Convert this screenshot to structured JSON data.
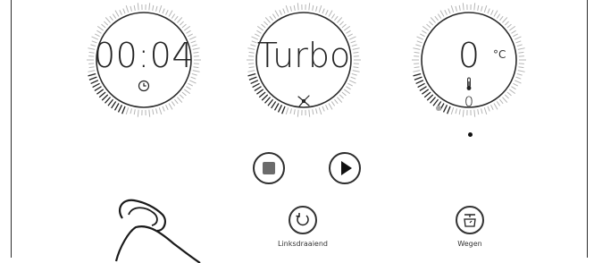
{
  "dials": {
    "time": {
      "value": "00:04",
      "icon": "clock-icon"
    },
    "speed": {
      "value": "Turbo",
      "icon": "fan-blade-icon"
    },
    "temp": {
      "value": "0",
      "unit": "°C",
      "icon": "thermometer-icon",
      "sub_value": "0"
    }
  },
  "controls": {
    "stop_icon": "stop-icon",
    "play_icon": "play-icon"
  },
  "functions": {
    "reverse": {
      "label": "Linksdraaiend",
      "icon": "reverse-rotation-icon"
    },
    "weigh": {
      "label": "Wegen",
      "icon": "scale-icon"
    }
  },
  "colors": {
    "accent": "#2d2d2d",
    "tick": "#b5b5b5",
    "muted_dot": "#a8a8a8"
  }
}
